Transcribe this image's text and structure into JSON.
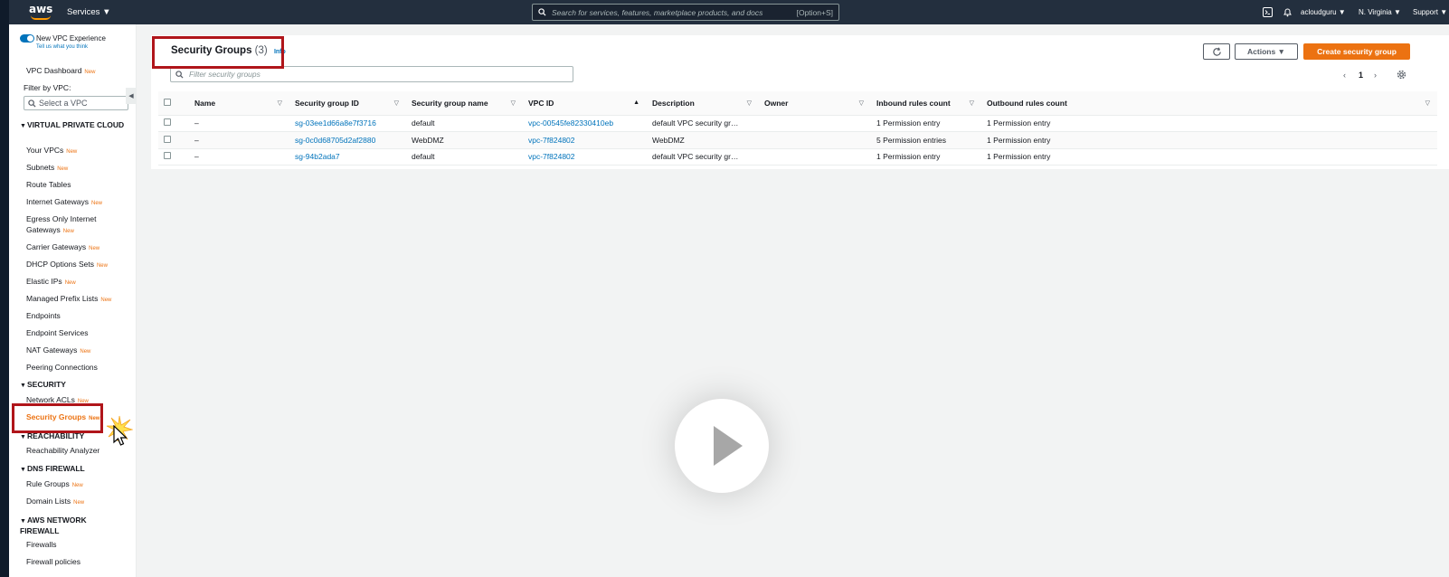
{
  "topnav": {
    "logo_text": "aws",
    "services_label": "Services ▼",
    "search_placeholder": "Search for services, features, marketplace products, and docs",
    "search_shortcut": "[Option+S]",
    "account": "acloudguru ▼",
    "region": "N. Virginia ▼",
    "support": "Support ▼"
  },
  "sidebar": {
    "new_experience": "New VPC Experience",
    "tell_us": "Tell us what you think",
    "dashboard": "VPC Dashboard",
    "new_badge": "New",
    "filter_label": "Filter by VPC:",
    "select_placeholder": "Select a VPC",
    "sections": {
      "vpc": "VIRTUAL PRIVATE CLOUD",
      "security": "SECURITY",
      "reachability": "REACHABILITY",
      "dns_firewall": "DNS FIREWALL",
      "network_firewall": "AWS NETWORK FIREWALL"
    },
    "items": {
      "your_vpcs": "Your VPCs",
      "subnets": "Subnets",
      "route_tables": "Route Tables",
      "internet_gateways": "Internet Gateways",
      "egress_only_1": "Egress Only Internet",
      "egress_only_2": "Gateways",
      "carrier_gateways": "Carrier Gateways",
      "dhcp_options": "DHCP Options Sets",
      "elastic_ips": "Elastic IPs",
      "managed_prefix": "Managed Prefix Lists",
      "endpoints": "Endpoints",
      "endpoint_services": "Endpoint Services",
      "nat_gateways": "NAT Gateways",
      "peering": "Peering Connections",
      "network_acls": "Network ACLs",
      "security_groups": "Security Groups",
      "reachability_analyzer": "Reachability Analyzer",
      "rule_groups": "Rule Groups",
      "domain_lists": "Domain Lists",
      "firewalls": "Firewalls",
      "firewall_policies": "Firewall policies"
    }
  },
  "main": {
    "title": "Security Groups",
    "count": "(3)",
    "info": "Info",
    "filter_placeholder": "Filter security groups",
    "actions_label": "Actions ▼",
    "create_label": "Create security group",
    "page": "1",
    "columns": [
      "Name",
      "Security group ID",
      "Security group name",
      "VPC ID",
      "Description",
      "Owner",
      "Inbound rules count",
      "Outbound rules count"
    ],
    "rows": [
      [
        "–",
        "sg-03ee1d66a8e7f3716",
        "default",
        "vpc-00545fe82330410eb",
        "default VPC security gr…",
        "",
        "1 Permission entry",
        "1 Permission entry"
      ],
      [
        "–",
        "sg-0c0d68705d2af2880",
        "WebDMZ",
        "vpc-7f824802",
        "WebDMZ",
        "",
        "5 Permission entries",
        "1 Permission entry"
      ],
      [
        "–",
        "sg-94b2ada7",
        "default",
        "vpc-7f824802",
        "default VPC security gr…",
        "",
        "1 Permission entry",
        "1 Permission entry"
      ]
    ]
  }
}
